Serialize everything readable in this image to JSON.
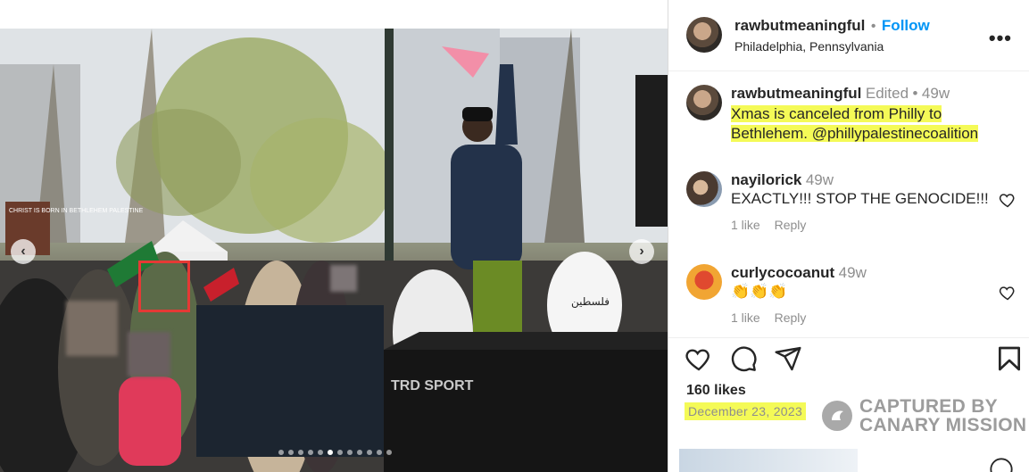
{
  "post": {
    "username": "rawbutmeaningful",
    "follow_label": "Follow",
    "separator": "•",
    "location": "Philadelphia, Pennsylvania",
    "more_label": "•••"
  },
  "photo": {
    "sign_text": "CHRIST IS BORN IN BETHLEHEM PALESTINE",
    "hoodie_text": "فلسطين",
    "truck_text": "TRD SPORT",
    "carousel_total": 12,
    "carousel_active": 5
  },
  "caption": {
    "username": "rawbutmeaningful",
    "edited": "Edited",
    "dot": "•",
    "time": "49w",
    "line1": "Xmas is canceled from Philly to",
    "line2": "Bethlehem. @phillypalestinecoalition"
  },
  "comments": [
    {
      "username": "nayilorick",
      "time": "49w",
      "text": "EXACTLY!!! STOP THE GENOCIDE!!!",
      "likes": "1 like",
      "reply": "Reply"
    },
    {
      "username": "curlycocoanut",
      "time": "49w",
      "text": "👏👏👏",
      "likes": "1 like",
      "reply": "Reply"
    }
  ],
  "likes": "160 likes",
  "date": "December 23, 2023",
  "watermark": {
    "line1": "CAPTURED BY",
    "line2": "CANARY MISSION"
  },
  "colors": {
    "follow": "#0095f6",
    "highlight": "#f4fa57",
    "red_box": "#e53935"
  }
}
